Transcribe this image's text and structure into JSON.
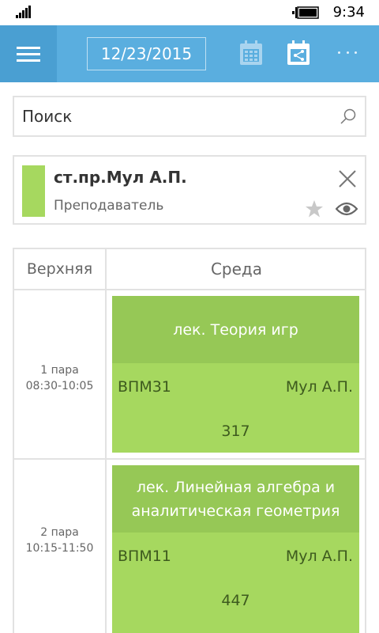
{
  "status_bar": {
    "time": "9:34",
    "icons": [
      "signal-icon",
      "battery-icon"
    ]
  },
  "app_bar": {
    "menu_icon": "hamburger-menu-icon",
    "date": "12/23/2015",
    "actions": [
      "calendar-icon",
      "calendar-share-icon",
      "more-icon"
    ],
    "accent": "#5aaedf"
  },
  "search": {
    "placeholder": "Поиск",
    "icon": "search-icon"
  },
  "teacher_card": {
    "name": "ст.пр.Мул А.П.",
    "role": "Преподаватель",
    "color": "#a6d85f",
    "actions": [
      "close-icon",
      "star-icon",
      "eye-icon"
    ]
  },
  "schedule": {
    "week_header": "Верхняя",
    "day_header": "Среда",
    "rows": [
      {
        "pair": "1 пара",
        "time": "08:30-10:05",
        "lesson": {
          "title": "лек. Теория игр",
          "group": "ВПМ31",
          "teacher": "Мул А.П.",
          "room": "317"
        }
      },
      {
        "pair": "2 пара",
        "time": "10:15-11:50",
        "lesson": {
          "title": "лек. Линейная алгебра и аналитическая геометрия",
          "group": "ВПМ11",
          "teacher": "Мул А.П.",
          "room": "447"
        }
      }
    ],
    "lesson_color": "#a6d85f",
    "lesson_header_color": "#96c856"
  }
}
